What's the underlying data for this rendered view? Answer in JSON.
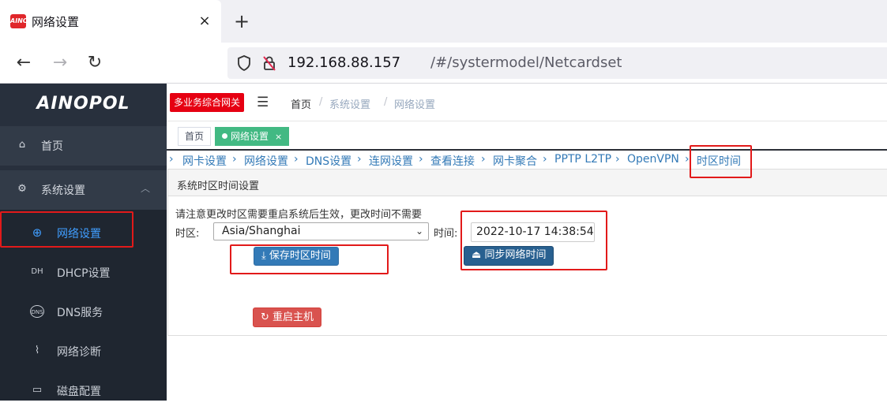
{
  "browser": {
    "tab_title": "网络设置",
    "favicon_text": "AINO",
    "tab_close": "×",
    "new_tab": "+",
    "back_icon": "←",
    "forward_icon": "→",
    "reload_icon": "↻",
    "url_host": "192.168.88.157",
    "url_path": "/#/systermodel/Netcardset"
  },
  "sidebar": {
    "logo": "AINOPOL",
    "home": "首页",
    "system_settings": "系统设置",
    "items": [
      {
        "label": "网络设置",
        "icon": "globe-gear-icon"
      },
      {
        "label": "DHCP设置",
        "icon_text": "DH"
      },
      {
        "label": "DNS服务",
        "icon_text": "DNS"
      },
      {
        "label": "网络诊断",
        "icon": "pulse-icon"
      },
      {
        "label": "磁盘配置",
        "icon": "disk-icon"
      }
    ]
  },
  "header": {
    "badge": "多业务综合网关",
    "breadcrumb": [
      "首页",
      "系统设置",
      "网络设置"
    ],
    "separator": "/"
  },
  "tags": {
    "home": "首页",
    "active": "网络设置",
    "close": "×"
  },
  "subnav": [
    "网卡设置",
    "网络设置",
    "DNS设置",
    "连网设置",
    "查看连接",
    "网卡聚合",
    "PPTP L2TP",
    "OpenVPN",
    "时区时间"
  ],
  "panel": {
    "title": "系统时区时间设置",
    "notice": "请注意更改时区需要重启系统后生效，更改时间不需要",
    "timezone_label": "时区:",
    "timezone_value": "Asia/Shanghai",
    "time_label": "时间:",
    "time_value": "2022-10-17 14:38:54",
    "save_button": "保存时区时间",
    "sync_button": "同步网络时间",
    "reboot_button": "重启主机"
  },
  "colors": {
    "sidebar_bg": "#28303d",
    "accent": "#409eff",
    "tag_active": "#42b983",
    "badge": "#e60012",
    "annotation": "#e21a1a"
  }
}
